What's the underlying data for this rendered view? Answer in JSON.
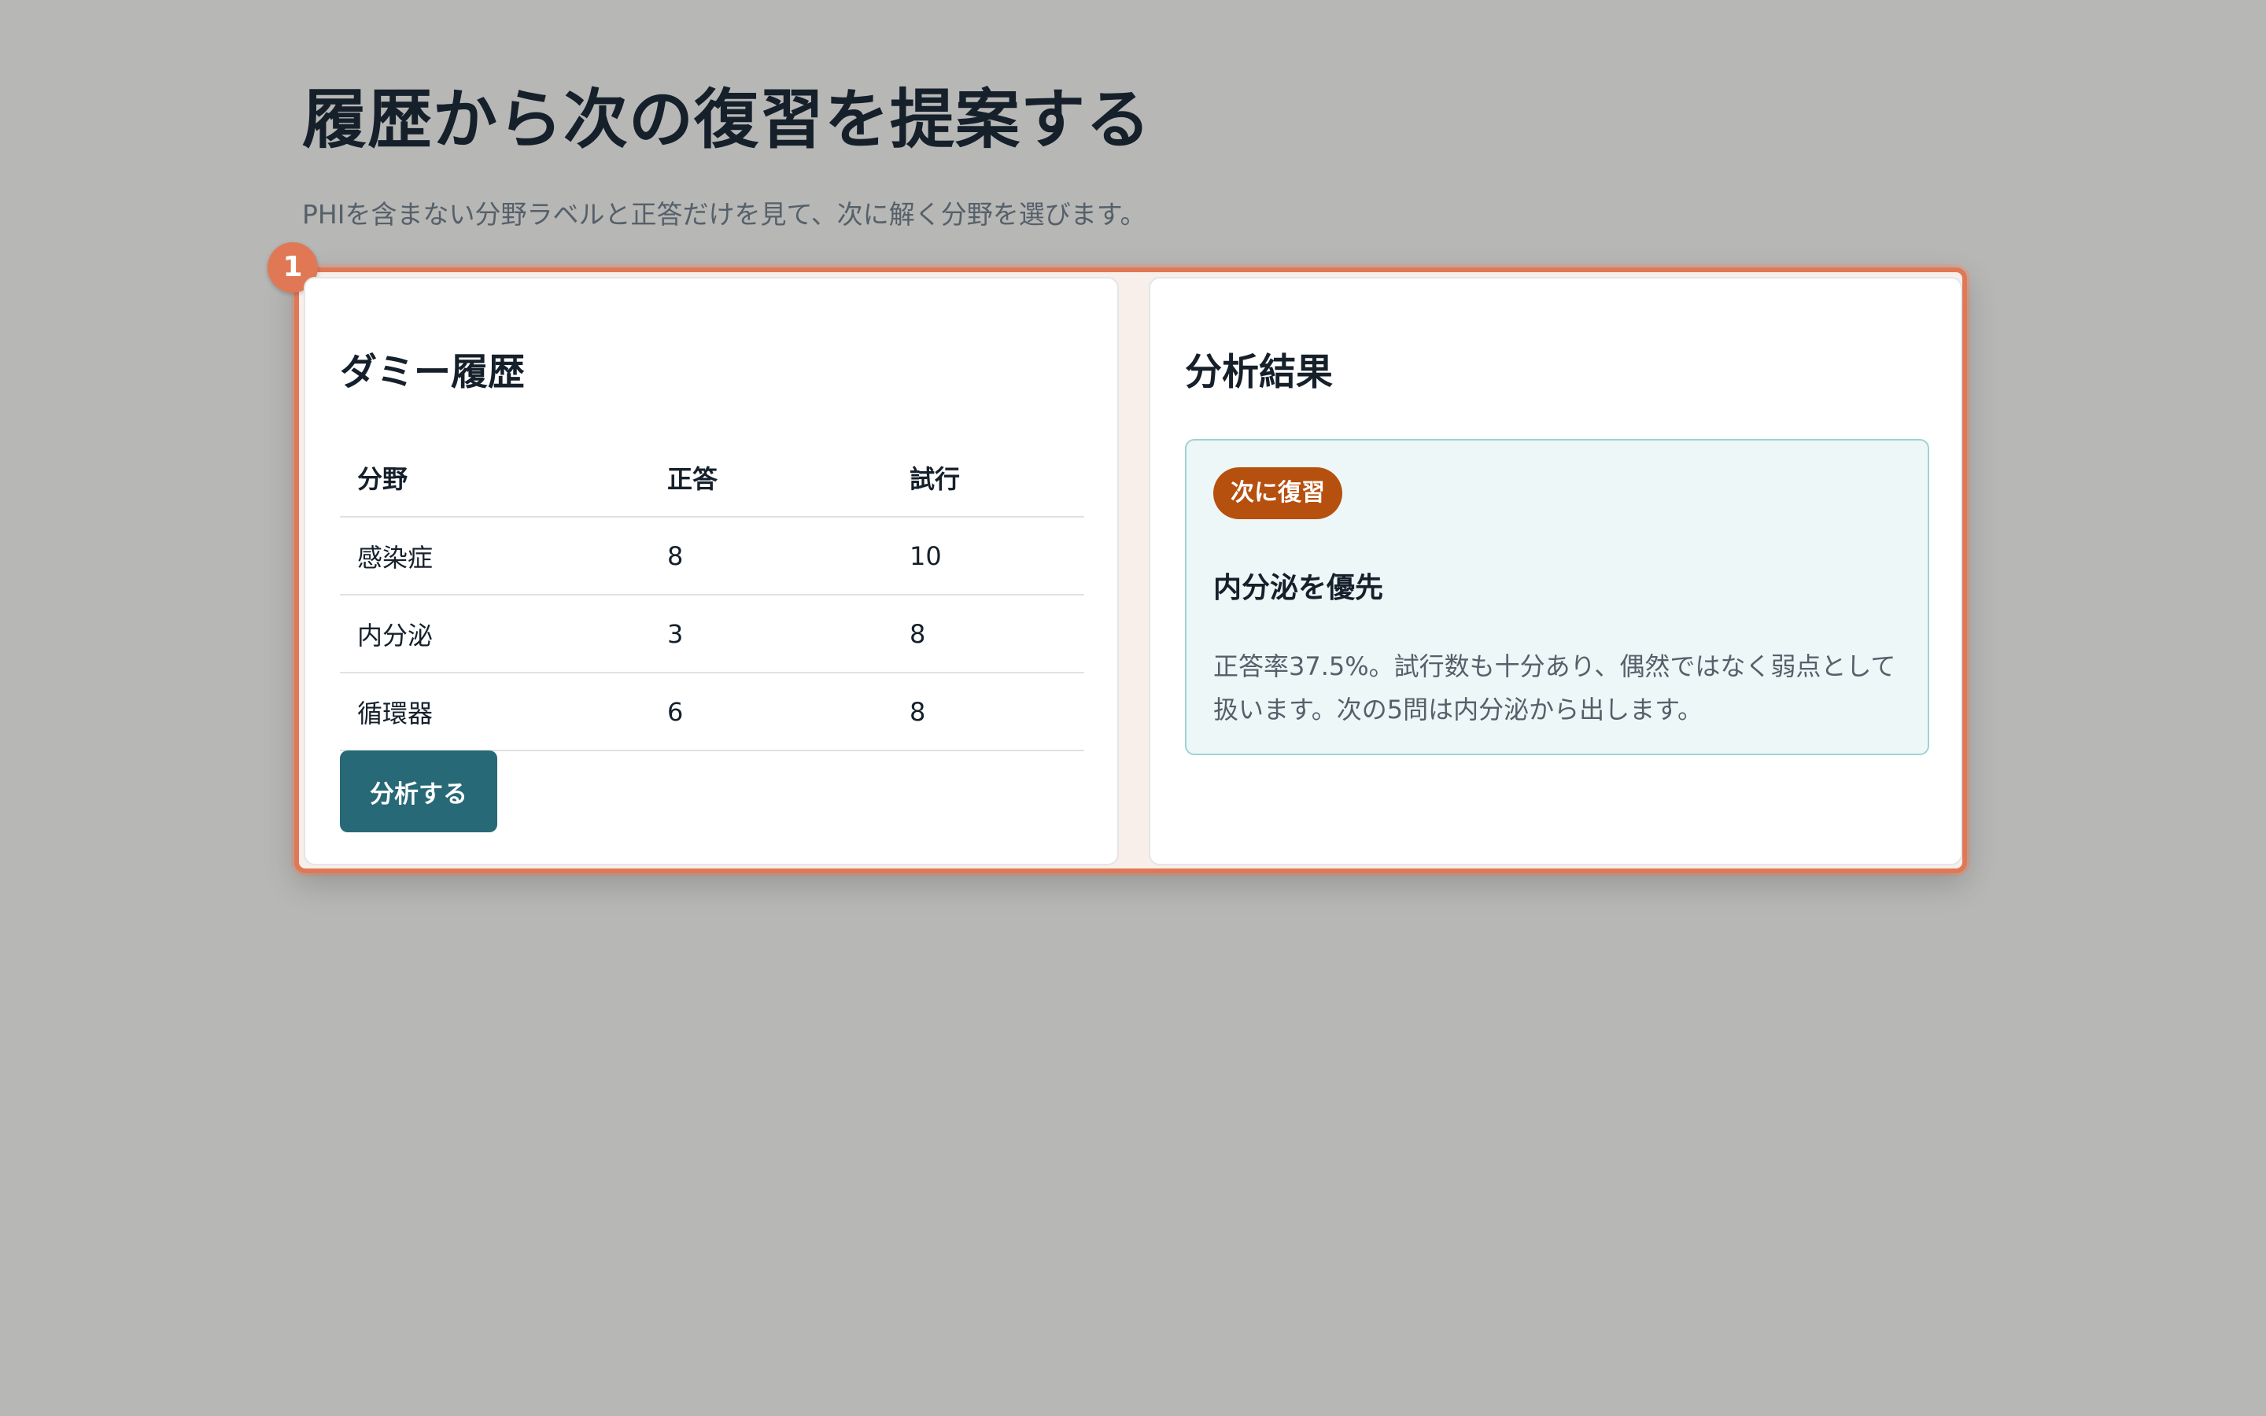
{
  "page": {
    "title": "履歴から次の復習を提案する",
    "subtitle": "PHIを含まない分野ラベルと正答だけを見て、次に解く分野を選びます。"
  },
  "annotation": {
    "step_number": "1",
    "highlight_color": "#e07856"
  },
  "history": {
    "title": "ダミー履歴",
    "columns": [
      "分野",
      "正答",
      "試行"
    ],
    "rows": [
      [
        "感染症",
        "8",
        "10"
      ],
      [
        "内分泌",
        "3",
        "8"
      ],
      [
        "循環器",
        "6",
        "8"
      ]
    ],
    "analyze_button_label": "分析する",
    "button_color": "#276976"
  },
  "result": {
    "title": "分析結果",
    "badge": "次に復習",
    "badge_color": "#b6500f",
    "heading": "内分泌を優先",
    "body": "正答率37.5%。試行数も十分あり、偶然ではなく弱点として扱います。次の5問は内分泌から出します。"
  }
}
